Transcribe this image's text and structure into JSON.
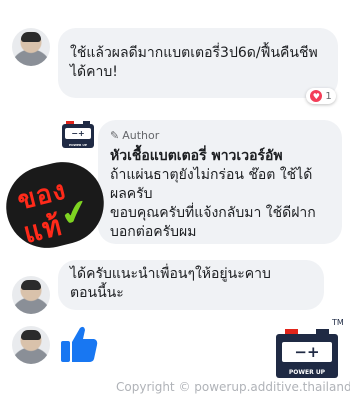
{
  "comments": [
    {
      "text_lines": [
        "ใช้แล้วผลดีมากแบตเตอรี่3ป6ด/ฟื้นคืนชีพ",
        "ได้คาบ!"
      ],
      "reaction_count": "1"
    },
    {
      "author_badge": "Author",
      "author_name": "หัวเชื้อแบตเตอรี่ พาวเวอร์อัพ",
      "text_lines": [
        "ถ้าแผ่นธาตุยังไม่กร่อน ช๊อต ใช้ได้",
        "ผลครับ",
        "ขอบคุณครับที่แจ้งกลับมา ใช้ดีฝาก",
        "บอกต่อครับผม"
      ]
    },
    {
      "text_lines": [
        "ได้ครับแนะนำเพื่อนๆให้อยู่นะคาบ",
        "ตอนนี้นะ"
      ]
    }
  ],
  "badge": {
    "top_text": "ของ",
    "bottom_text": "แท้",
    "check": "✔"
  },
  "logo": {
    "cells_text": "−+",
    "strip_text": "POWER UP",
    "tm": "TM"
  },
  "copyright": "Copyright © powerup.additive.thailand"
}
